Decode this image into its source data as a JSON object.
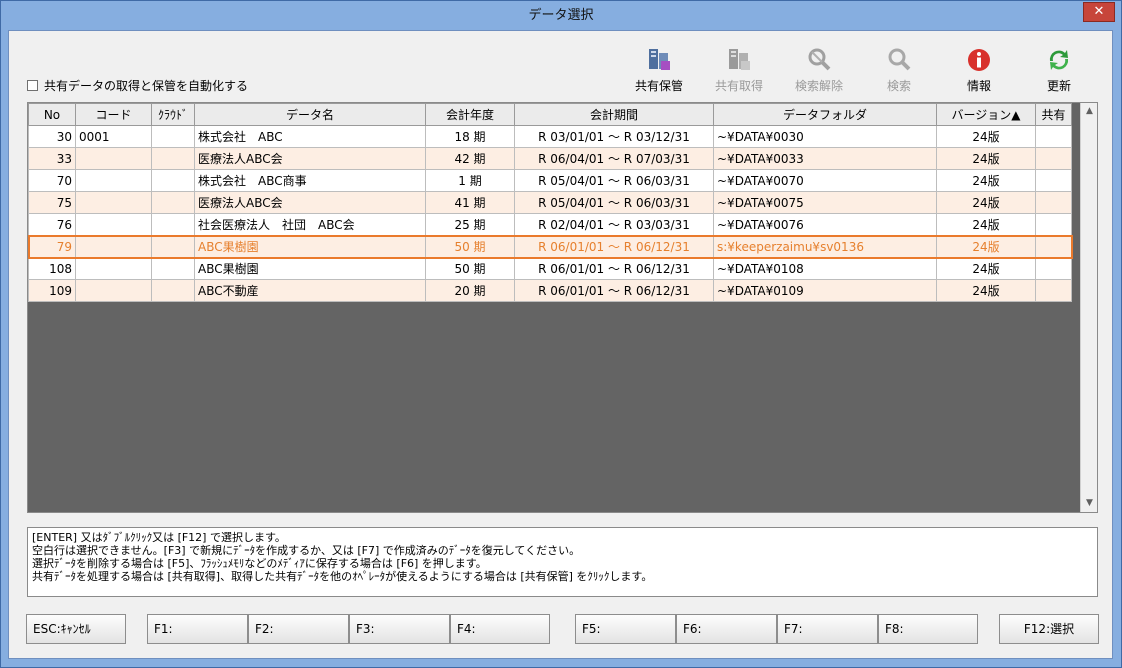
{
  "window": {
    "title": "データ選択",
    "close_glyph": "✕"
  },
  "auto_option": {
    "label": "共有データの取得と保管を自動化する",
    "checked": false
  },
  "toolbar": [
    {
      "label": "共有保管",
      "icon": "shared-save-icon",
      "enabled": true
    },
    {
      "label": "共有取得",
      "icon": "shared-get-icon",
      "enabled": false
    },
    {
      "label": "検索解除",
      "icon": "search-clear-icon",
      "enabled": false
    },
    {
      "label": "検索",
      "icon": "search-icon",
      "enabled": false
    },
    {
      "label": "情報",
      "icon": "info-icon",
      "enabled": true
    },
    {
      "label": "更新",
      "icon": "refresh-icon",
      "enabled": true
    }
  ],
  "grid": {
    "columns": [
      "No",
      "コード",
      "ｸﾗｳﾄﾞ",
      "データ名",
      "会計年度",
      "会計期間",
      "データフォルダ",
      "バージョン▲",
      "共有"
    ],
    "rows": [
      {
        "no": "30",
        "code": "0001",
        "cloud": "",
        "name": "株式会社　ABC",
        "year": "18 期",
        "period": "R 03/01/01 ～ R 03/12/31",
        "folder": "~¥DATA¥0030",
        "version": "24版",
        "shared": ""
      },
      {
        "no": "33",
        "code": "",
        "cloud": "",
        "name": "医療法人ABC会",
        "year": "42 期",
        "period": "R 06/04/01 ～ R 07/03/31",
        "folder": "~¥DATA¥0033",
        "version": "24版",
        "shared": ""
      },
      {
        "no": "70",
        "code": "",
        "cloud": "",
        "name": "株式会社　ABC商事",
        "year": "1 期",
        "period": "R 05/04/01 ～ R 06/03/31",
        "folder": "~¥DATA¥0070",
        "version": "24版",
        "shared": ""
      },
      {
        "no": "75",
        "code": "",
        "cloud": "",
        "name": "医療法人ABC会",
        "year": "41 期",
        "period": "R 05/04/01 ～ R 06/03/31",
        "folder": "~¥DATA¥0075",
        "version": "24版",
        "shared": ""
      },
      {
        "no": "76",
        "code": "",
        "cloud": "",
        "name": "社会医療法人　社団　ABC会",
        "year": "25 期",
        "period": "R 02/04/01 ～ R 03/03/31",
        "folder": "~¥DATA¥0076",
        "version": "24版",
        "shared": ""
      },
      {
        "no": "79",
        "code": "",
        "cloud": "",
        "name": "ABC果樹園",
        "year": "50 期",
        "period": "R 06/01/01 ～ R 06/12/31",
        "folder": "s:¥keeperzaimu¥sv0136",
        "version": "24版",
        "shared": ""
      },
      {
        "no": "108",
        "code": "",
        "cloud": "",
        "name": "ABC果樹園",
        "year": "50 期",
        "period": "R 06/01/01 ～ R 06/12/31",
        "folder": "~¥DATA¥0108",
        "version": "24版",
        "shared": ""
      },
      {
        "no": "109",
        "code": "",
        "cloud": "",
        "name": "ABC不動産",
        "year": "20 期",
        "period": "R 06/01/01 ～ R 06/12/31",
        "folder": "~¥DATA¥0109",
        "version": "24版",
        "shared": ""
      }
    ],
    "selected_index": 5,
    "scroll_up_glyph": "▲",
    "scroll_down_glyph": "▼"
  },
  "messages": [
    "[ENTER] 又はﾀﾞﾌﾞﾙｸﾘｯｸ又は [F12] で選択します。",
    "空白行は選択できません。[F3] で新規にﾃﾞｰﾀを作成するか、又は [F7] で作成済みのﾃﾞｰﾀを復元してください。",
    "選択ﾃﾞｰﾀを削除する場合は [F5]、ﾌﾗｯｼｭﾒﾓﾘなどのﾒﾃﾞｨｱに保存する場合は [F6] を押します。",
    "共有ﾃﾞｰﾀを処理する場合は [共有取得]、取得した共有ﾃﾞｰﾀを他のｵﾍﾟﾚｰﾀが使えるようにする場合は [共有保管] をｸﾘｯｸします。"
  ],
  "fkeys": {
    "esc": "ESC:ｷｬﾝｾﾙ",
    "f1": "F1:",
    "f2": "F2:",
    "f3": "F3:",
    "f4": "F4:",
    "f5": "F5:",
    "f6": "F6:",
    "f7": "F7:",
    "f8": "F8:",
    "f12": "F12:選択"
  }
}
